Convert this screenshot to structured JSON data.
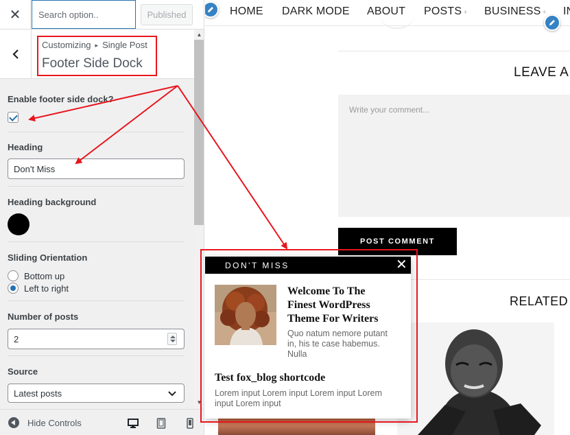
{
  "topbar": {
    "close_glyph": "✕",
    "search_placeholder": "Search option..",
    "publish_label": "Published"
  },
  "section": {
    "crumb_parent": "Customizing",
    "crumb_sep": "▸",
    "crumb_child": "Single Post",
    "title": "Footer Side Dock"
  },
  "controls": {
    "enable_label": "Enable footer side dock?",
    "enable_checked": true,
    "heading_label": "Heading",
    "heading_value": "Don't Miss",
    "bg_label": "Heading background",
    "bg_color": "#000000",
    "orientation_label": "Sliding Orientation",
    "orientation_options": [
      {
        "label": "Bottom up",
        "checked": false
      },
      {
        "label": "Left to right",
        "checked": true
      }
    ],
    "posts_label": "Number of posts",
    "posts_value": "2",
    "source_label": "Source",
    "source_value": "Latest posts"
  },
  "footer": {
    "hide_label": "Hide Controls",
    "devices": [
      "desktop-icon",
      "tablet-icon",
      "mobile-icon"
    ]
  },
  "nav": [
    {
      "label": "HOME",
      "plus": ""
    },
    {
      "label": "DARK MODE",
      "plus": ""
    },
    {
      "label": "ABOUT",
      "plus": ""
    },
    {
      "label": "POSTS",
      "plus": "+"
    },
    {
      "label": "BUSINESS",
      "plus": "+"
    },
    {
      "label": "IN",
      "plus": ""
    }
  ],
  "comments": {
    "leave_reply": "LEAVE A",
    "comment_placeholder": "Write your comment...",
    "post_button": "POST COMMENT"
  },
  "related": {
    "heading": "RELATED"
  },
  "dock": {
    "heading": "DON'T MISS",
    "close_glyph": "✕",
    "posts": [
      {
        "title_lines": [
          "Welcome To The",
          "Finest WordPress",
          "Theme For Writers"
        ],
        "excerpt_lines": [
          "Quo natum nemore putant",
          "in, his te case habemus.",
          "Nulla"
        ]
      },
      {
        "title": "Test fox_blog shortcode",
        "excerpt_lines": [
          "Lorem input Lorem input Lorem input Lorem",
          "input Lorem input"
        ]
      }
    ]
  },
  "colors": {
    "accent": "#2271b1",
    "annotation": "#e8151c",
    "edit_pen": "#3582c4",
    "dock_header": "#000000"
  }
}
